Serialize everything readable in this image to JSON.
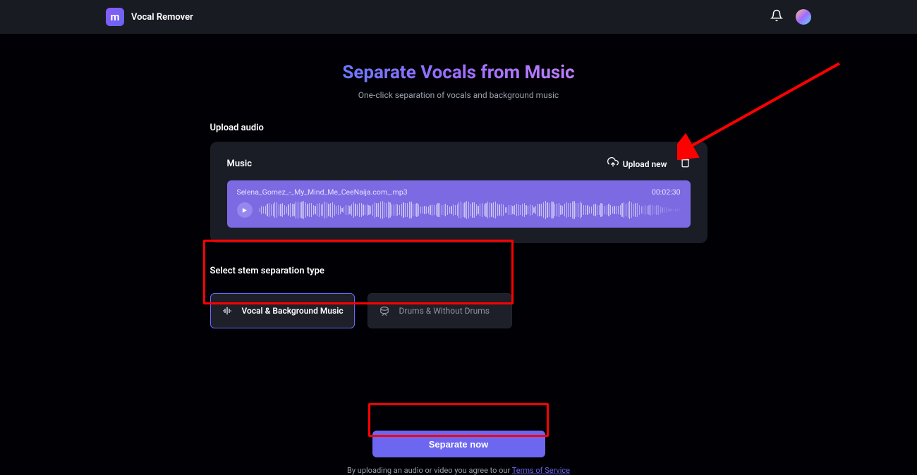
{
  "header": {
    "app_name": "Vocal Remover",
    "logo_glyph": "m"
  },
  "hero": {
    "title": "Separate Vocals from Music",
    "subtitle": "One-click separation of vocals and background music"
  },
  "upload": {
    "section_label": "Upload audio",
    "music_label": "Music",
    "upload_new_label": "Upload new",
    "track": {
      "filename": "Selena_Gomez_-_My_Mind_Me_CeeNaija.com_.mp3",
      "duration": "00:02:30"
    }
  },
  "separation": {
    "section_label": "Select stem separation type",
    "options": [
      {
        "label": "Vocal & Background Music",
        "selected": true,
        "icon": "sound-wave-icon"
      },
      {
        "label": "Drums & Without Drums",
        "selected": false,
        "icon": "drums-icon"
      }
    ]
  },
  "cta": {
    "button_label": "Separate now",
    "terms_text": "By uploading an audio or video you agree to our ",
    "terms_link_label": "Terms of Service"
  }
}
